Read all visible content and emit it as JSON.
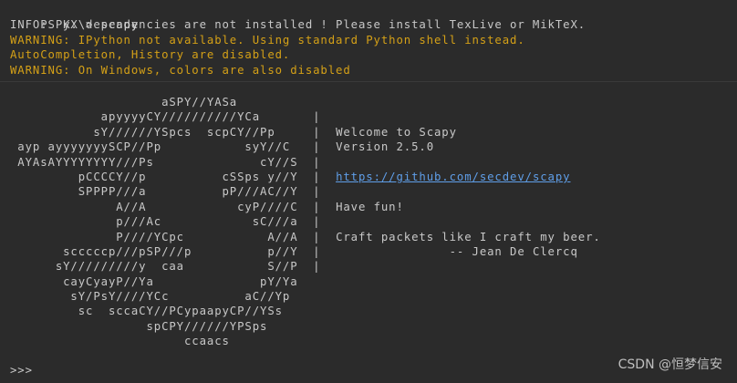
{
  "terminal": {
    "prompt": "PS K:\\> ",
    "command": "scapy",
    "info_line": "INFO: PyX dependencies are not installed ! Please install TexLive or MikTeX.",
    "warning_lines": [
      "WARNING: IPython not available. Using standard Python shell instead.",
      "AutoCompletion, History are disabled.",
      "WARNING: On Windows, colors are also disabled"
    ],
    "banner_rows": [
      {
        "art": "                    aSPY//YASa",
        "sep": "",
        "text": ""
      },
      {
        "art": "            apyyyyCY//////////YCa       ",
        "sep": "|",
        "text": ""
      },
      {
        "art": "           sY//////YSpcs  scpCY//Pp     ",
        "sep": "|",
        "text": "Welcome to Scapy"
      },
      {
        "art": " ayp ayyyyyyySCP//Pp           syY//C   ",
        "sep": "|",
        "text": "Version 2.5.0"
      },
      {
        "art": " AYAsAYYYYYYYY///Ps              cY//S  ",
        "sep": "|",
        "text": ""
      },
      {
        "art": "         pCCCCY//p          cSSps y//Y  ",
        "sep": "|",
        "text": "https://github.com/secdev/scapy",
        "link": true
      },
      {
        "art": "         SPPPP///a          pP///AC//Y  ",
        "sep": "|",
        "text": ""
      },
      {
        "art": "              A//A            cyP////C  ",
        "sep": "|",
        "text": "Have fun!"
      },
      {
        "art": "              p///Ac            sC///a  ",
        "sep": "|",
        "text": ""
      },
      {
        "art": "              P////YCpc           A//A  ",
        "sep": "|",
        "text": "Craft packets like I craft my beer."
      },
      {
        "art": "       scccccp///pSP///p          p//Y  ",
        "sep": "|",
        "text": "               -- Jean De Clercq"
      },
      {
        "art": "      sY/////////y  caa           S//P  ",
        "sep": "|",
        "text": ""
      },
      {
        "art": "       cayCyayP//Ya              pY/Ya",
        "sep": "",
        "text": ""
      },
      {
        "art": "        sY/PsY////YCc          aC//Yp",
        "sep": "",
        "text": ""
      },
      {
        "art": "         sc  sccaCY//PCypaapyCP//YSs",
        "sep": "",
        "text": ""
      },
      {
        "art": "                  spCPY//////YPSps",
        "sep": "",
        "text": ""
      },
      {
        "art": "                       ccaacs",
        "sep": "",
        "text": ""
      }
    ],
    "repl_prompt": ">>> "
  },
  "watermark": "CSDN @恒梦信安",
  "colors": {
    "background": "#2b2b2b",
    "text": "#c8c8c8",
    "warning": "#d4a017",
    "link": "#5f9ee8"
  }
}
